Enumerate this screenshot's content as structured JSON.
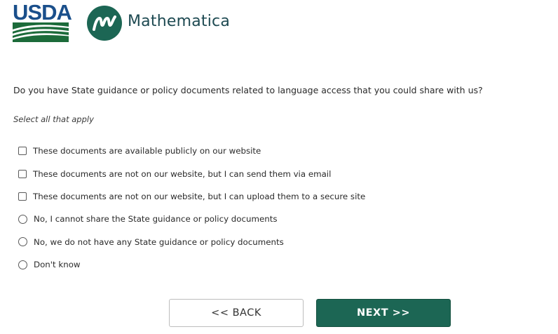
{
  "header": {
    "usda_label": "USDA",
    "brand_name": "Mathematica",
    "colors": {
      "usda_blue": "#1a4f8b",
      "usda_green": "#1c6b3a",
      "mathematica_teal": "#1c6654"
    }
  },
  "survey": {
    "question": "Do you have State guidance or policy documents related to language access that you could share with us?",
    "instruction": "Select all that apply",
    "options": [
      {
        "type": "checkbox",
        "label": "These documents are available publicly on our website",
        "checked": false
      },
      {
        "type": "checkbox",
        "label": "These documents are not on our website, but I can send them via email",
        "checked": false
      },
      {
        "type": "checkbox",
        "label": "These documents are not on our website, but I can upload them to a secure site",
        "checked": false
      },
      {
        "type": "radio",
        "label": "No, I cannot share the State guidance or policy documents",
        "checked": false
      },
      {
        "type": "radio",
        "label": "No, we do not have any State guidance or policy documents",
        "checked": false
      },
      {
        "type": "radio",
        "label": "Don't know",
        "checked": false
      }
    ]
  },
  "navigation": {
    "back_label": "<< BACK",
    "next_label": "NEXT >>"
  }
}
